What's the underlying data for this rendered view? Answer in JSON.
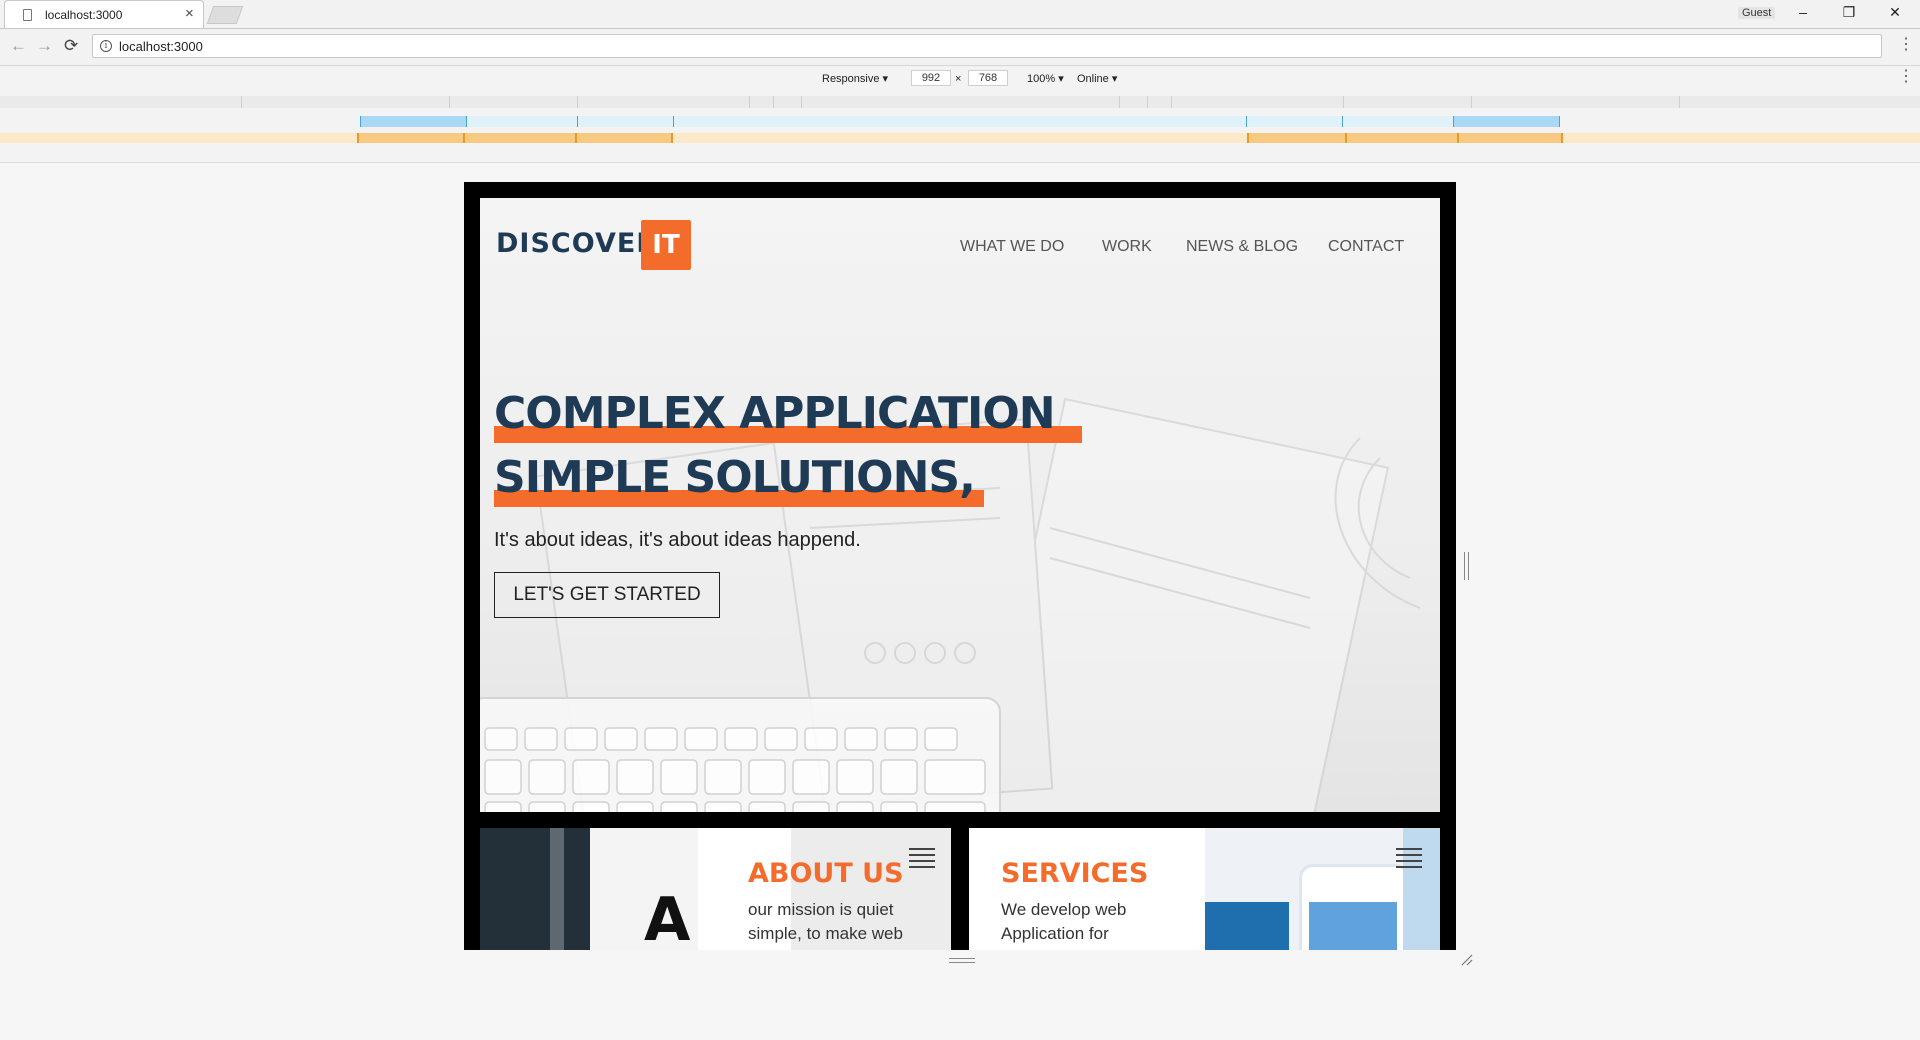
{
  "browser": {
    "tab_title": "localhost:3000",
    "tab_close": "×",
    "user_badge": "Guest",
    "window_controls": {
      "minimize": "–",
      "restore": "❐",
      "close": "✕"
    },
    "nav": {
      "back": "←",
      "forward": "→",
      "reload": "⟳"
    },
    "url": "localhost:3000",
    "menu": "⋮"
  },
  "devtools": {
    "device_mode": "Responsive ▾",
    "width": "992",
    "times": "×",
    "height": "768",
    "zoom": "100% ▾",
    "network": "Online ▾",
    "menu": "⋮"
  },
  "site": {
    "logo_text": "DISCOVER",
    "logo_badge": "IT",
    "nav": [
      "WHAT WE DO",
      "WORK",
      "NEWS & BLOG",
      "CONTACT"
    ],
    "headline_line1": "COMPLEX APPLICATION",
    "headline_line2": "SIMPLE SOLUTIONS,",
    "subtitle": "It's about ideas, it's about ideas happend.",
    "cta": "LET'S GET STARTED",
    "about": {
      "title": "ABOUT US",
      "text_line1": "our mission is quiet",
      "text_line2": "simple, to make web"
    },
    "services": {
      "title": "SERVICES",
      "text_line1": "We develop web",
      "text_line2": "Application for"
    }
  },
  "colors": {
    "accent": "#f36c2c",
    "brand_dark": "#1e3a55"
  }
}
